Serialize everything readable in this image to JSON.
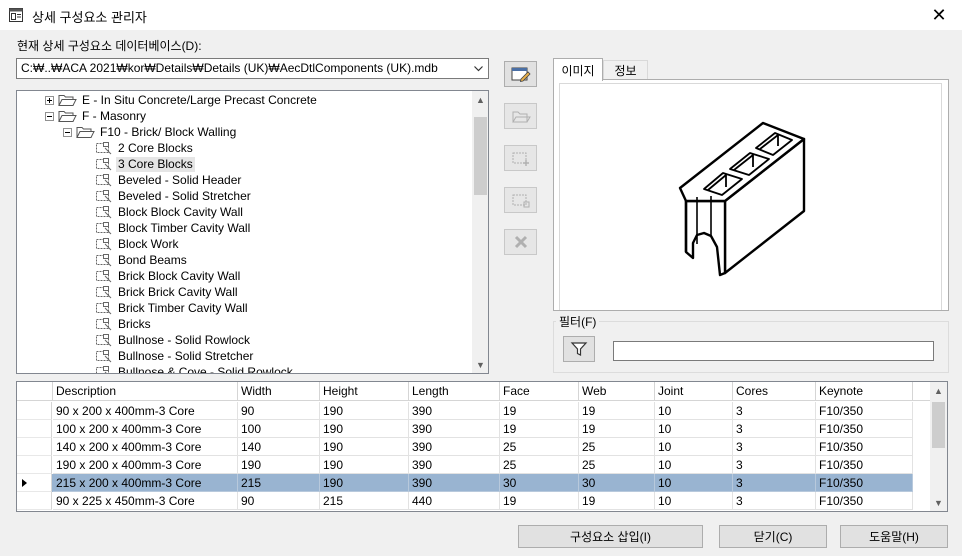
{
  "window": {
    "title": "상세 구성요소 관리자",
    "close_symbol": "✕"
  },
  "database": {
    "label": "현재 상세 구성요소 데이터베이스(D):",
    "path": "C:₩..₩ACA 2021₩kor₩Details₩Details (UK)₩AecDtlComponents (UK).mdb"
  },
  "tree": {
    "nodes": [
      {
        "label": "E - In Situ Concrete/Large Precast Concrete",
        "expander": "plus",
        "icon": "folder",
        "level": 1
      },
      {
        "label": "F - Masonry",
        "expander": "minus",
        "icon": "folder",
        "level": 1
      },
      {
        "label": "F10 - Brick/ Block Walling",
        "expander": "minus",
        "icon": "folder",
        "level": 2
      },
      {
        "label": "2 Core Blocks",
        "icon": "component",
        "level": 3
      },
      {
        "label": "3 Core Blocks",
        "icon": "component",
        "level": 3,
        "selected": true
      },
      {
        "label": "Beveled - Solid Header",
        "icon": "component",
        "level": 3
      },
      {
        "label": "Beveled - Solid Stretcher",
        "icon": "component",
        "level": 3
      },
      {
        "label": "Block Block Cavity Wall",
        "icon": "component",
        "level": 3
      },
      {
        "label": "Block Timber Cavity Wall",
        "icon": "component",
        "level": 3
      },
      {
        "label": "Block Work",
        "icon": "component",
        "level": 3
      },
      {
        "label": "Bond Beams",
        "icon": "component",
        "level": 3
      },
      {
        "label": "Brick Block Cavity Wall",
        "icon": "component",
        "level": 3
      },
      {
        "label": "Brick Brick Cavity Wall",
        "icon": "component",
        "level": 3
      },
      {
        "label": "Brick Timber Cavity Wall",
        "icon": "component",
        "level": 3
      },
      {
        "label": "Bricks",
        "icon": "component",
        "level": 3
      },
      {
        "label": "Bullnose - Solid Rowlock",
        "icon": "component",
        "level": 3
      },
      {
        "label": "Bullnose - Solid Stretcher",
        "icon": "component",
        "level": 3
      },
      {
        "label": "Bullnose & Cove - Solid Rowlock",
        "icon": "component",
        "level": 3
      }
    ]
  },
  "toolbar": [
    {
      "name": "edit-component-icon",
      "enabled": true
    },
    {
      "name": "open-folder-icon",
      "enabled": false
    },
    {
      "name": "new-component-icon",
      "enabled": false
    },
    {
      "name": "copy-component-icon",
      "enabled": false
    },
    {
      "name": "delete-icon",
      "enabled": false
    }
  ],
  "tabs": [
    {
      "label": "이미지",
      "active": true
    },
    {
      "label": "정보",
      "active": false
    }
  ],
  "filter": {
    "label": "필터(F)",
    "value": ""
  },
  "grid": {
    "columns": [
      "Description",
      "Width",
      "Height",
      "Length",
      "Face",
      "Web",
      "Joint",
      "Cores",
      "Keynote"
    ],
    "rows": [
      {
        "cells": [
          "90 x 200 x 400mm-3 Core",
          "90",
          "190",
          "390",
          "19",
          "19",
          "10",
          "3",
          "F10/350"
        ],
        "selected": false
      },
      {
        "cells": [
          "100 x 200 x 400mm-3 Core",
          "100",
          "190",
          "390",
          "19",
          "19",
          "10",
          "3",
          "F10/350"
        ],
        "selected": false
      },
      {
        "cells": [
          "140 x 200 x 400mm-3 Core",
          "140",
          "190",
          "390",
          "25",
          "25",
          "10",
          "3",
          "F10/350"
        ],
        "selected": false
      },
      {
        "cells": [
          "190 x 200 x 400mm-3 Core",
          "190",
          "190",
          "390",
          "25",
          "25",
          "10",
          "3",
          "F10/350"
        ],
        "selected": false
      },
      {
        "cells": [
          "215 x 200 x 400mm-3 Core",
          "215",
          "190",
          "390",
          "30",
          "30",
          "10",
          "3",
          "F10/350"
        ],
        "selected": true
      },
      {
        "cells": [
          "90 x 225 x 450mm-3 Core",
          "90",
          "215",
          "440",
          "19",
          "19",
          "10",
          "3",
          "F10/350"
        ],
        "selected": false
      }
    ]
  },
  "buttons": {
    "insert": "구성요소 삽입(I)",
    "close": "닫기(C)",
    "help": "도움말(H)"
  }
}
